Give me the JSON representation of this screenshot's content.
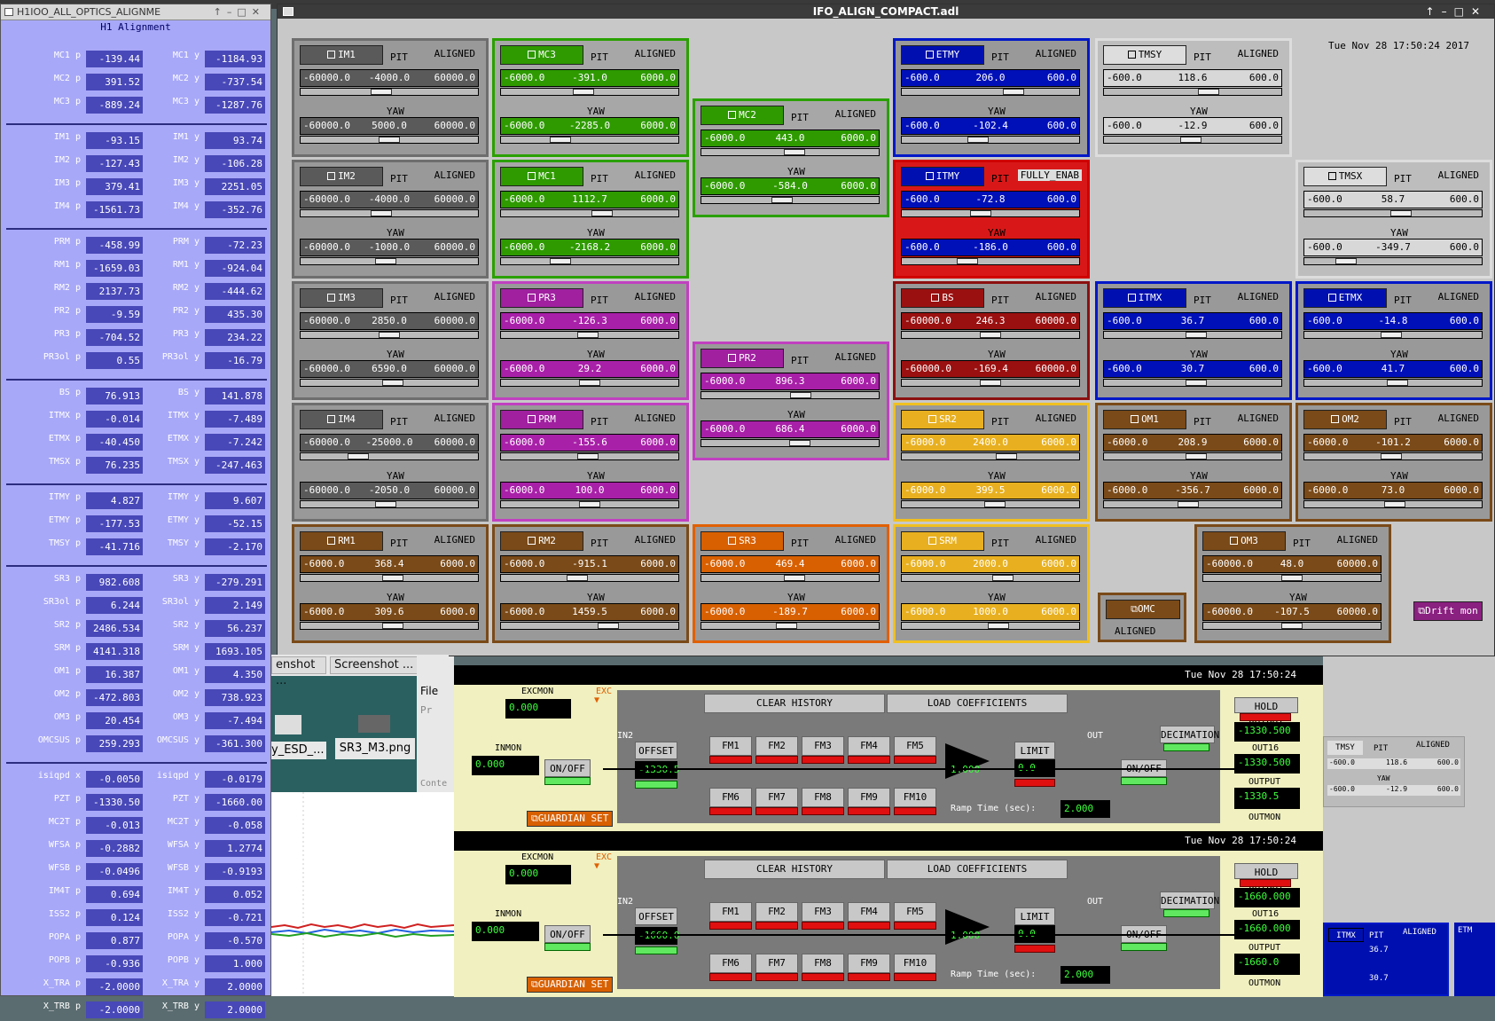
{
  "left_panel": {
    "title": "H1IOO_ALL_OPTICS_ALIGNME",
    "subtitle": "H1 Alignment",
    "groups": [
      [
        [
          "MC1 p",
          "-139.44",
          "MC1 y",
          "-1184.93"
        ],
        [
          "MC2 p",
          "391.52",
          "MC2 y",
          "-737.54"
        ],
        [
          "MC3 p",
          "-889.24",
          "MC3 y",
          "-1287.76"
        ]
      ],
      [
        [
          "IM1 p",
          "-93.15",
          "IM1 y",
          "93.74"
        ],
        [
          "IM2 p",
          "-127.43",
          "IM2 y",
          "-106.28"
        ],
        [
          "IM3 p",
          "379.41",
          "IM3 y",
          "2251.05"
        ],
        [
          "IM4 p",
          "-1561.73",
          "IM4 y",
          "-352.76"
        ]
      ],
      [
        [
          "PRM p",
          "-458.99",
          "PRM y",
          "-72.23"
        ],
        [
          "RM1 p",
          "-1659.03",
          "RM1 y",
          "-924.04"
        ],
        [
          "RM2 p",
          "2137.73",
          "RM2 y",
          "-444.62"
        ],
        [
          "PR2 p",
          "-9.59",
          "PR2 y",
          "435.30"
        ],
        [
          "PR3 p",
          "-704.52",
          "PR3 y",
          "234.22"
        ],
        [
          "PR3ol p",
          "0.55",
          "PR3ol y",
          "-16.79"
        ]
      ],
      [
        [
          "BS p",
          "76.913",
          "BS y",
          "141.878"
        ],
        [
          "ITMX p",
          "-0.014",
          "ITMX y",
          "-7.489"
        ],
        [
          "ETMX p",
          "-40.450",
          "ETMX y",
          "-7.242"
        ],
        [
          "TMSX p",
          "76.235",
          "TMSX y",
          "-247.463"
        ]
      ],
      [
        [
          "ITMY p",
          "4.827",
          "ITMY y",
          "9.607"
        ],
        [
          "ETMY p",
          "-177.53",
          "ETMY y",
          "-52.15"
        ],
        [
          "TMSY p",
          "-41.716",
          "TMSY y",
          "-2.170"
        ]
      ],
      [
        [
          "SR3 p",
          "982.608",
          "SR3 y",
          "-279.291"
        ],
        [
          "SR3ol p",
          "6.244",
          "SR3ol y",
          "2.149"
        ],
        [
          "SR2 p",
          "2486.534",
          "SR2 y",
          "56.237"
        ],
        [
          "SRM p",
          "4141.318",
          "SRM y",
          "1693.105"
        ],
        [
          "OM1 p",
          "16.387",
          "OM1 y",
          "4.350"
        ],
        [
          "OM2 p",
          "-472.803",
          "OM2 y",
          "738.923"
        ],
        [
          "OM3 p",
          "20.454",
          "OM3 y",
          "-7.494"
        ],
        [
          "OMCSUS p",
          "259.293",
          "OMCSUS y",
          "-361.300"
        ]
      ],
      [
        [
          "isiqpd x",
          "-0.0050",
          "isiqpd y",
          "-0.0179"
        ],
        [
          "PZT p",
          "-1330.50",
          "PZT y",
          "-1660.00"
        ],
        [
          "MC2T p",
          "-0.013",
          "MC2T y",
          "-0.058"
        ],
        [
          "WFSA p",
          "-0.2882",
          "WFSA y",
          "1.2774"
        ],
        [
          "WFSB p",
          "-0.0496",
          "WFSB y",
          "-0.9193"
        ],
        [
          "IM4T p",
          "0.694",
          "IM4T y",
          "0.052"
        ],
        [
          "ISS2 p",
          "0.124",
          "ISS2 y",
          "-0.721"
        ],
        [
          "POPA p",
          "0.877",
          "POPA y",
          "-0.570"
        ],
        [
          "POPB p",
          "-0.936",
          "POPB y",
          "1.000"
        ],
        [
          "X_TRA p",
          "-2.0000",
          "X_TRA y",
          "2.0000"
        ],
        [
          "X_TRB p",
          "-2.0000",
          "X_TRB y",
          "2.0000"
        ]
      ]
    ]
  },
  "main_window": {
    "title": "IFO_ALIGN_COMPACT.adl",
    "datetime": "Tue Nov 28 17:50:24 2017",
    "pit_label": "PIT",
    "yaw_label": "YAW",
    "optics": [
      {
        "name": "IM1",
        "color": "gray",
        "status": "ALIGNED",
        "pit": [
          "-60000.0",
          "-4000.0",
          "60000.0"
        ],
        "yaw": [
          "-60000.0",
          "5000.0",
          "60000.0"
        ],
        "pk": 0.45,
        "yk": 0.5
      },
      {
        "name": "IM2",
        "color": "gray",
        "status": "ALIGNED",
        "pit": [
          "-60000.0",
          "-4000.0",
          "60000.0"
        ],
        "yaw": [
          "-60000.0",
          "-1000.0",
          "60000.0"
        ],
        "pk": 0.45,
        "yk": 0.48
      },
      {
        "name": "IM3",
        "color": "gray",
        "status": "ALIGNED",
        "pit": [
          "-60000.0",
          "2850.0",
          "60000.0"
        ],
        "yaw": [
          "-60000.0",
          "6590.0",
          "60000.0"
        ],
        "pk": 0.5,
        "yk": 0.52
      },
      {
        "name": "IM4",
        "color": "gray",
        "status": "ALIGNED",
        "pit": [
          "-60000.0",
          "-25000.0",
          "60000.0"
        ],
        "yaw": [
          "-60000.0",
          "-2050.0",
          "60000.0"
        ],
        "pk": 0.3,
        "yk": 0.48
      },
      {
        "name": "RM1",
        "color": "brown",
        "status": "ALIGNED",
        "pit": [
          "-6000.0",
          "368.4",
          "6000.0"
        ],
        "yaw": [
          "-6000.0",
          "309.6",
          "6000.0"
        ],
        "pk": 0.52,
        "yk": 0.52
      },
      {
        "name": "MC3",
        "color": "green",
        "status": "ALIGNED",
        "pit": [
          "-6000.0",
          "-391.0",
          "6000.0"
        ],
        "yaw": [
          "-6000.0",
          "-2285.0",
          "6000.0"
        ],
        "pk": 0.46,
        "yk": 0.31
      },
      {
        "name": "MC1",
        "color": "green",
        "status": "ALIGNED",
        "pit": [
          "-6000.0",
          "1112.7",
          "6000.0"
        ],
        "yaw": [
          "-6000.0",
          "-2168.2",
          "6000.0"
        ],
        "pk": 0.58,
        "yk": 0.31
      },
      {
        "name": "PR3",
        "color": "purple",
        "status": "ALIGNED",
        "pit": [
          "-6000.0",
          "-126.3",
          "6000.0"
        ],
        "yaw": [
          "-6000.0",
          "29.2",
          "6000.0"
        ],
        "pk": 0.49,
        "yk": 0.5
      },
      {
        "name": "PRM",
        "color": "purple",
        "status": "ALIGNED",
        "pit": [
          "-6000.0",
          "-155.6",
          "6000.0"
        ],
        "yaw": [
          "-6000.0",
          "100.0",
          "6000.0"
        ],
        "pk": 0.49,
        "yk": 0.5
      },
      {
        "name": "RM2",
        "color": "brown",
        "status": "ALIGNED",
        "pit": [
          "-6000.0",
          "-915.1",
          "6000.0"
        ],
        "yaw": [
          "-6000.0",
          "1459.5",
          "6000.0"
        ],
        "pk": 0.42,
        "yk": 0.62
      },
      {
        "name": "MC2",
        "color": "green",
        "status": "ALIGNED",
        "pit": [
          "-6000.0",
          "443.0",
          "6000.0"
        ],
        "yaw": [
          "-6000.0",
          "-584.0",
          "6000.0"
        ],
        "pk": 0.53,
        "yk": 0.45
      },
      {
        "name": "PR2",
        "color": "purple",
        "status": "ALIGNED",
        "pit": [
          "-6000.0",
          "896.3",
          "6000.0"
        ],
        "yaw": [
          "-6000.0",
          "686.4",
          "6000.0"
        ],
        "pk": 0.57,
        "yk": 0.56
      },
      {
        "name": "SR3",
        "color": "orange",
        "status": "ALIGNED",
        "pit": [
          "-6000.0",
          "469.4",
          "6000.0"
        ],
        "yaw": [
          "-6000.0",
          "-189.7",
          "6000.0"
        ],
        "pk": 0.53,
        "yk": 0.48
      },
      {
        "name": "ETMY",
        "color": "blue",
        "status": "ALIGNED",
        "pit": [
          "-600.0",
          "206.0",
          "600.0"
        ],
        "yaw": [
          "-600.0",
          "-102.4",
          "600.0"
        ],
        "pk": 0.65,
        "yk": 0.42
      },
      {
        "name": "ITMY",
        "color": "red",
        "status": "FULLY_ENAB",
        "pit": [
          "-600.0",
          "-72.8",
          "600.0"
        ],
        "yaw": [
          "-600.0",
          "-186.0",
          "600.0"
        ],
        "pk": 0.44,
        "yk": 0.35
      },
      {
        "name": "BS",
        "color": "dred",
        "status": "ALIGNED",
        "pit": [
          "-60000.0",
          "246.3",
          "60000.0"
        ],
        "yaw": [
          "-60000.0",
          "-169.4",
          "60000.0"
        ],
        "pk": 0.5,
        "yk": 0.5
      },
      {
        "name": "SR2",
        "color": "yellow",
        "status": "ALIGNED",
        "pit": [
          "-6000.0",
          "2400.0",
          "6000.0"
        ],
        "yaw": [
          "-6000.0",
          "399.5",
          "6000.0"
        ],
        "pk": 0.6,
        "yk": 0.53
      },
      {
        "name": "SRM",
        "color": "yellow",
        "status": "ALIGNED",
        "pit": [
          "-6000.0",
          "2000.0",
          "6000.0"
        ],
        "yaw": [
          "-6000.0",
          "1000.0",
          "6000.0"
        ],
        "pk": 0.58,
        "yk": 0.55
      },
      {
        "name": "TMSY",
        "color": "light",
        "status": "ALIGNED",
        "pit": [
          "-600.0",
          "118.6",
          "600.0"
        ],
        "yaw": [
          "-600.0",
          "-12.9",
          "600.0"
        ],
        "pk": 0.6,
        "yk": 0.49
      },
      {
        "name": "ITMX",
        "color": "blue",
        "status": "ALIGNED",
        "pit": [
          "-600.0",
          "36.7",
          "600.0"
        ],
        "yaw": [
          "-600.0",
          "30.7",
          "600.0"
        ],
        "pk": 0.52,
        "yk": 0.52
      },
      {
        "name": "OM1",
        "color": "brown",
        "status": "ALIGNED",
        "pit": [
          "-6000.0",
          "208.9",
          "6000.0"
        ],
        "yaw": [
          "-6000.0",
          "-356.7",
          "6000.0"
        ],
        "pk": 0.52,
        "yk": 0.47
      },
      {
        "name": "TMSX",
        "color": "light",
        "status": "ALIGNED",
        "pit": [
          "-600.0",
          "58.7",
          "600.0"
        ],
        "yaw": [
          "-600.0",
          "-349.7",
          "600.0"
        ],
        "pk": 0.55,
        "yk": 0.2
      },
      {
        "name": "ETMX",
        "color": "blue",
        "status": "ALIGNED",
        "pit": [
          "-600.0",
          "-14.8",
          "600.0"
        ],
        "yaw": [
          "-600.0",
          "41.7",
          "600.0"
        ],
        "pk": 0.49,
        "yk": 0.53
      },
      {
        "name": "OM2",
        "color": "brown",
        "status": "ALIGNED",
        "pit": [
          "-6000.0",
          "-101.2",
          "6000.0"
        ],
        "yaw": [
          "-6000.0",
          "73.0",
          "6000.0"
        ],
        "pk": 0.49,
        "yk": 0.51
      },
      {
        "name": "OM3",
        "color": "brown",
        "status": "ALIGNED",
        "pit": [
          "-60000.0",
          "48.0",
          "60000.0"
        ],
        "yaw": [
          "-60000.0",
          "-107.5",
          "60000.0"
        ],
        "pk": 0.5,
        "yk": 0.5
      }
    ],
    "omc": {
      "name": "OMC",
      "status": "ALIGNED"
    },
    "drift_mon": "Drift mon"
  },
  "taskbar": {
    "tab1": "enshot ...",
    "tab2": "Screenshot ...",
    "file_menu": "File",
    "pr": "Pr",
    "conte": "Conte",
    "item1": "y_ESD_...",
    "item2": "SR3_M3.png"
  },
  "filters": [
    {
      "datetime": "Tue Nov 28 17:50:24",
      "excmon": "0.000",
      "inmon": "0.000",
      "offset": "-1330.5",
      "gain": "1.000",
      "limit_val": "0.0",
      "ramp": "2.000",
      "out16": "-1330.500",
      "output": "-1330.500",
      "outmon": "-1330.5",
      "hold_output": "HOLD OUTPUT"
    },
    {
      "datetime": "Tue Nov 28 17:50:24",
      "excmon": "0.000",
      "inmon": "0.000",
      "offset": "-1660.0",
      "gain": "1.000",
      "limit_val": "0.0",
      "ramp": "2.000",
      "out16": "-1660.000",
      "output": "-1660.000",
      "outmon": "-1660.0",
      "hold_output": "HOLD OUTPUT"
    }
  ],
  "filter_labels": {
    "excmon": "EXCMON",
    "exc": "EXC",
    "inmon": "INMON",
    "in2": "IN2",
    "onoff": "ON/OFF",
    "offset": "OFFSET",
    "clear": "CLEAR HISTORY",
    "load": "LOAD COEFFICIENTS",
    "limit": "LIMIT",
    "out": "OUT",
    "decimation": "DECIMATION",
    "out16": "OUT16",
    "output": "OUTPUT",
    "outmon": "OUTMON",
    "ramp": "Ramp Time (sec):",
    "guardian": "GUARDIAN SET",
    "fms": [
      "FM1",
      "FM2",
      "FM3",
      "FM4",
      "FM5",
      "FM6",
      "FM7",
      "FM8",
      "FM9",
      "FM10"
    ]
  },
  "right_side": {
    "tmsy": "TMSY",
    "pit": "PIT",
    "aligned": "ALIGNED",
    "pv": "118.6",
    "yv": "-12.9",
    "lo": "-600.0",
    "hi": "600.0",
    "yaw": "YAW",
    "itmx": "ITMX",
    "itmxv": "36.7",
    "itmxy": "30.7",
    "etm": "ETM"
  }
}
